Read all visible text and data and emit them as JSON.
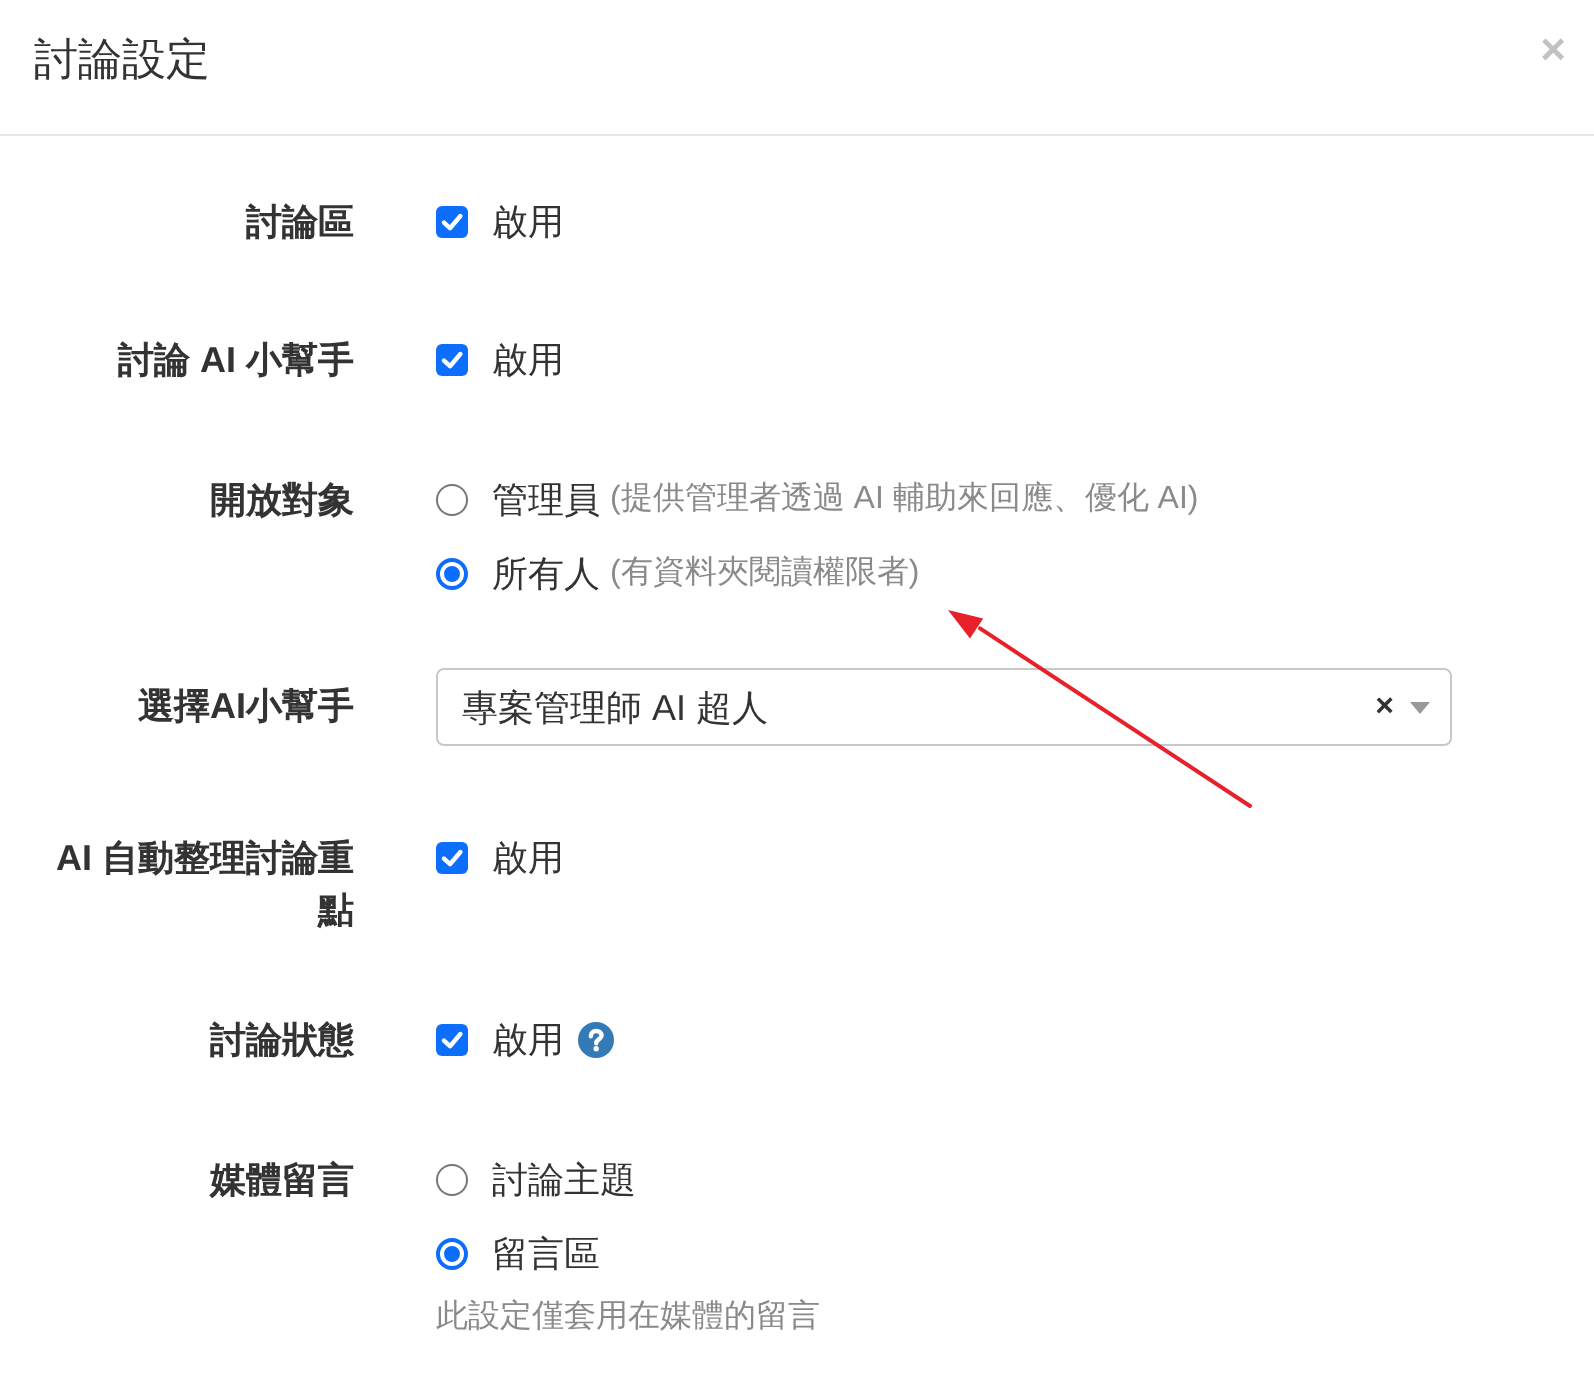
{
  "dialog": {
    "title": "討論設定",
    "close": "×"
  },
  "fields": [
    {
      "kind": "checkbox",
      "label": "討論區",
      "option": "啟用",
      "checked": true
    },
    {
      "kind": "checkbox",
      "label": "討論 AI 小幫手",
      "option": "啟用",
      "checked": true
    },
    {
      "kind": "radio",
      "label": "開放對象",
      "options": [
        {
          "label": "管理員",
          "note": "(提供管理者透過 AI 輔助來回應、優化 AI)",
          "selected": false
        },
        {
          "label": "所有人",
          "note": "(有資料夾閱讀權限者)",
          "selected": true
        }
      ]
    },
    {
      "kind": "select",
      "label": "選擇AI小幫手",
      "value": "專案管理師 AI 超人",
      "clear": "×"
    },
    {
      "kind": "checkbox",
      "label": "AI 自動整理討論重點",
      "option": "啟用",
      "checked": true
    },
    {
      "kind": "checkbox",
      "label": "討論狀態",
      "option": "啟用",
      "checked": true,
      "help": true
    },
    {
      "kind": "radio",
      "label": "媒體留言",
      "options": [
        {
          "label": "討論主題",
          "selected": false
        },
        {
          "label": "留言區",
          "selected": true
        }
      ],
      "hint": "此設定僅套用在媒體的留言"
    }
  ]
}
